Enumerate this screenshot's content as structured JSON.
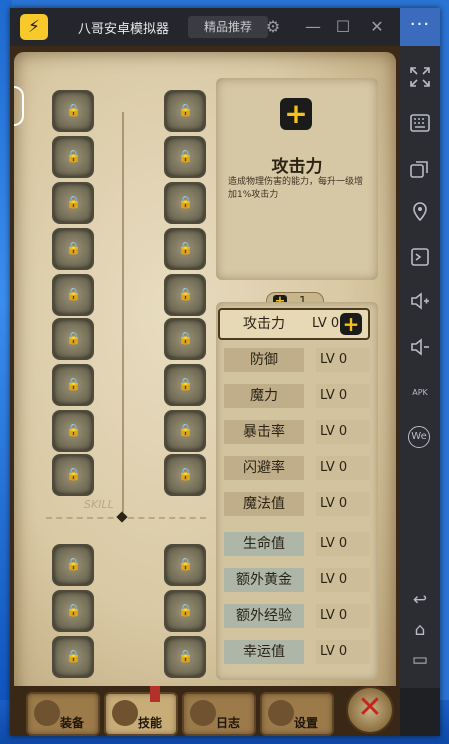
{
  "window": {
    "app_title": "八哥安卓模拟器",
    "recommend_button": "精品推荐",
    "settings_icon": "gear-icon",
    "minimize_icon": "minimize-icon",
    "maximize_icon": "maximize-icon",
    "close_icon": "close-icon"
  },
  "sidebar": {
    "more_label": "···",
    "items": [
      {
        "name": "fullscreen-icon"
      },
      {
        "name": "keyboard-icon"
      },
      {
        "name": "multi-window-icon"
      },
      {
        "name": "location-icon"
      },
      {
        "name": "screenshot-icon"
      },
      {
        "name": "volume-up-icon"
      },
      {
        "name": "volume-down-icon"
      },
      {
        "name": "apk-install-icon",
        "label": "APK"
      },
      {
        "name": "wechat-icon",
        "label": "We"
      },
      {
        "name": "back-icon"
      },
      {
        "name": "home-icon"
      },
      {
        "name": "recent-apps-icon"
      }
    ]
  },
  "skill_tree": {
    "watermark": "SKILL"
  },
  "detail": {
    "title": "攻击力",
    "description": "造成物理伤害的能力，每升一级增加1%攻击力"
  },
  "points": {
    "value": "1"
  },
  "stats": [
    {
      "name": "攻击力",
      "level": "LV 0",
      "selected": true
    },
    {
      "name": "防御",
      "level": "LV 0"
    },
    {
      "name": "魔力",
      "level": "LV 0"
    },
    {
      "name": "暴击率",
      "level": "LV 0"
    },
    {
      "name": "闪避率",
      "level": "LV 0"
    },
    {
      "name": "魔法值",
      "level": "LV 0"
    },
    {
      "name": "生命值",
      "level": "LV 0"
    },
    {
      "name": "额外黄金",
      "level": "LV 0"
    },
    {
      "name": "额外经验",
      "level": "LV 0"
    },
    {
      "name": "幸运值",
      "level": "LV 0"
    }
  ],
  "tabs": [
    {
      "label": "装备"
    },
    {
      "label": "技能",
      "active": true
    },
    {
      "label": "日志"
    },
    {
      "label": "设置"
    }
  ],
  "colors": {
    "accent_yellow": "#f4c21a",
    "close_red": "#c72420",
    "parchment": "#d9c9a4"
  }
}
